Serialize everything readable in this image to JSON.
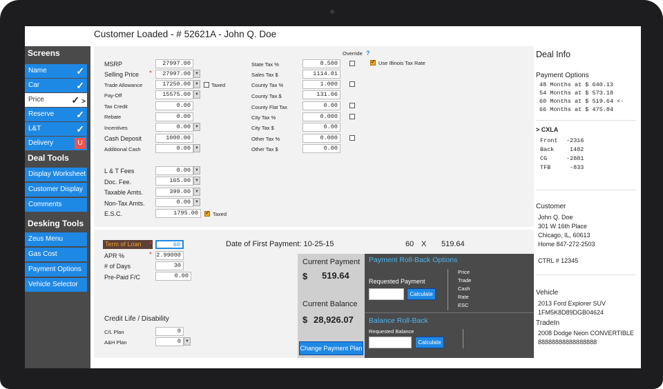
{
  "header": {
    "title": "Customer Loaded -   # 52621A - John Q. Doe"
  },
  "sidebar": {
    "screens_title": "Screens",
    "screens": [
      {
        "label": "Name",
        "status": "✓"
      },
      {
        "label": "Car",
        "status": "✓"
      },
      {
        "label": "Price",
        "status": "✓",
        "arrow": ">"
      },
      {
        "label": "Reserve",
        "status": "✓"
      },
      {
        "label": "L&T",
        "status": "✓"
      },
      {
        "label": "Delivery",
        "status": "U"
      }
    ],
    "deal_tools_title": "Deal Tools",
    "deal_tools": [
      "Display Worksheet",
      "Customer Display",
      "Comments"
    ],
    "desking_title": "Desking Tools",
    "desking_tools": [
      "Zeus Menu",
      "Gas Cost",
      "Payment Options",
      "Vehicle Selector"
    ]
  },
  "price": {
    "override_label": "Override",
    "override_help": "?",
    "illinois_label": "Use Illinois Tax Rate",
    "taxed_label": "Taxed",
    "left": [
      {
        "label": "MSRP",
        "value": "27997.00"
      },
      {
        "label": "Selling Price",
        "value": "27997.00"
      },
      {
        "label": "Trade Allowance",
        "value": "17250.00"
      },
      {
        "label": "Pay-Off",
        "value": "15575.00"
      },
      {
        "label": "Tax Credit",
        "value": "0.00"
      },
      {
        "label": "Rebate",
        "value": "0.00"
      },
      {
        "label": "Incentives",
        "value": "0.00"
      },
      {
        "label": "Cash Deposit",
        "value": "1000.00"
      },
      {
        "label": "Additional Cash",
        "value": "0.00"
      }
    ],
    "fees": [
      {
        "label": "L & T Fees",
        "value": "0.00"
      },
      {
        "label": "Doc. Fee.",
        "value": "165.00"
      },
      {
        "label": "Taxable Amts.",
        "value": "399.00"
      },
      {
        "label": "Non-Tax Amts.",
        "value": "0.00"
      },
      {
        "label": "E.S.C.",
        "value": "1795.00"
      }
    ],
    "tax": [
      {
        "label": "State Tax %",
        "value": "8.500"
      },
      {
        "label": "Sales Tax $",
        "value": "1114.01"
      },
      {
        "label": "County  Tax %",
        "value": "1.000"
      },
      {
        "label": "County Tax $",
        "value": "131.06"
      },
      {
        "label": "County Flat Tax",
        "value": "0.00"
      },
      {
        "label": "City  Tax %",
        "value": "0.000"
      },
      {
        "label": "City Tax $",
        "value": "0.00"
      },
      {
        "label": "Other   Tax %",
        "value": "0.000"
      },
      {
        "label": "Other Tax $",
        "value": "0.00"
      }
    ]
  },
  "loan": {
    "term_label": "Term of Loan",
    "term_value": "60",
    "apr_label": "APR %",
    "apr_value": "2.99000",
    "days_label": "# of Days",
    "days_value": "30",
    "prepaid_label": "Pre-Paid F/C",
    "prepaid_value": "0.00",
    "credit_title": "Credit Life / Disability",
    "cl_label": "C/L Plan",
    "cl_value": "0",
    "ah_label": "A&H Plan",
    "ah_value": "0",
    "first_payment": "Date of First Payment: 10-25-15",
    "term_summary": "60",
    "times": "X",
    "payment_summary": "519.64"
  },
  "payment": {
    "current_payment_label": "Current Payment",
    "currency": "$",
    "current_payment": "519.64",
    "current_balance_label": "Current Balance",
    "current_balance": "28,926.07",
    "change_plan": "Change Payment Plan",
    "rollback_title": "Payment Roll-Back Options",
    "requested_payment": "Requested Payment",
    "calculate": "Calculate",
    "options": [
      "Price",
      "Trade",
      "Cash",
      "Rate",
      "ESC"
    ],
    "balance_title": "Balance Roll-Back",
    "requested_balance": "Requested Balance"
  },
  "deal_info": {
    "title": "Deal Info",
    "payment_options_title": "Payment Options",
    "payment_options": [
      "48 Months at $ 640.13",
      "54 Months at $ 573.18",
      "60 Months at $ 519.64 <-",
      "66 Months at $ 475.84"
    ],
    "cxla_title": "> CXLA",
    "cxla": [
      {
        "k": "Front",
        "v": "-2316"
      },
      {
        "k": "Back",
        "v": "1482"
      },
      {
        "k": "CG",
        "v": "-2881"
      },
      {
        "k": "TFB",
        "v": "-833"
      }
    ],
    "customer_title": "Customer",
    "customer": [
      "John Q. Doe",
      "301 W 16th Place",
      "Chicago, IL, 60613",
      "Home   847-272-2503"
    ],
    "ctrl": "CTRL #  12345",
    "vehicle_title": "Vehicle",
    "vehicle": [
      "2013 Ford Explorer SUV",
      "1FM5K8D89DGB04624"
    ],
    "tradein_title": "TradeIn",
    "tradein": [
      "2008 Dodge Neon CONVERTIBLE",
      "88888888888888888"
    ]
  },
  "colors": {
    "accent": "#1e88e5",
    "sidebar": "#4a4a4a",
    "alert": "#ef5350",
    "highlight": "#f5a623"
  }
}
